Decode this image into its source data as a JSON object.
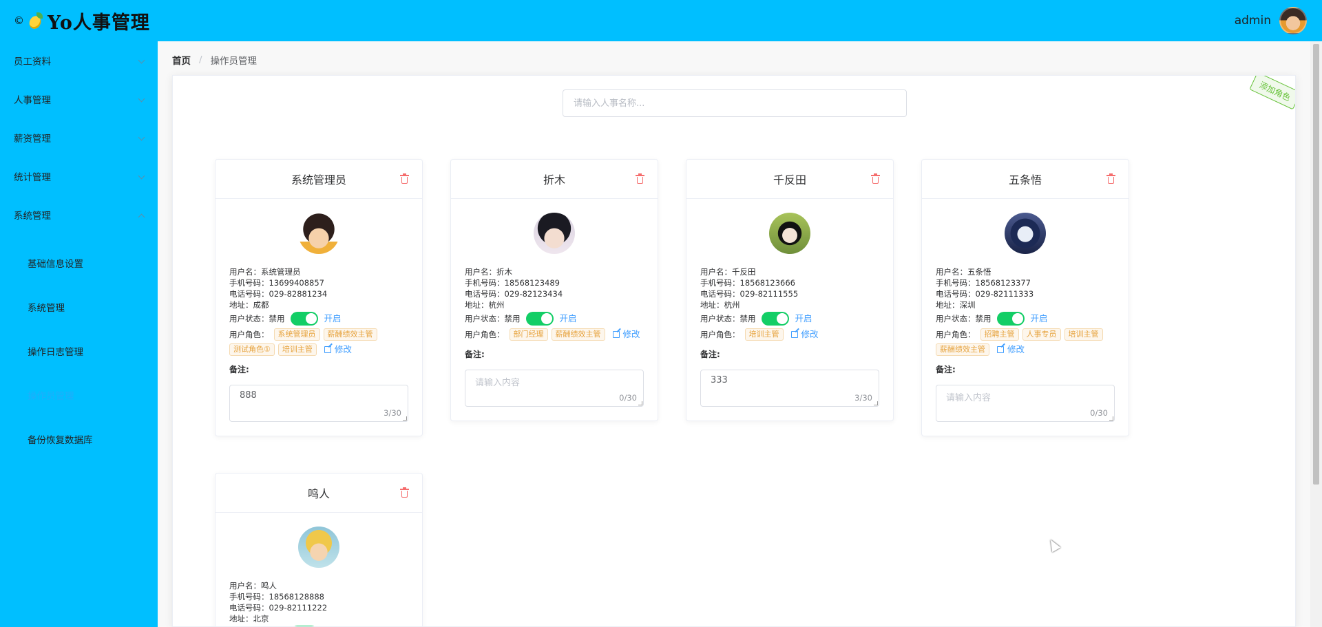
{
  "header": {
    "copyright": "©",
    "logo_icon": "pineapple-icon",
    "title": "Yo人事管理",
    "username": "admin"
  },
  "sidebar": {
    "items": [
      {
        "label": "员工资料"
      },
      {
        "label": "人事管理"
      },
      {
        "label": "薪资管理"
      },
      {
        "label": "统计管理"
      },
      {
        "label": "系统管理"
      }
    ],
    "sub_items": [
      {
        "label": "基础信息设置"
      },
      {
        "label": "系统管理"
      },
      {
        "label": "操作日志管理"
      },
      {
        "label": "操作员管理"
      },
      {
        "label": "备份恢复数据库"
      }
    ]
  },
  "breadcrumb": {
    "home": "首页",
    "separator": "/",
    "current": "操作员管理"
  },
  "add_role_label": "添加角色",
  "search": {
    "placeholder": "请输入人事名称..."
  },
  "labels": {
    "username": "用户名：",
    "mobile": "手机号码：",
    "phone": "电话号码：",
    "address": "地址：",
    "status": "用户状态：",
    "status_off": "禁用",
    "status_on": "开启",
    "roles": "用户角色：",
    "edit": "修改",
    "remark": "备注:",
    "remark_placeholder": "请输入内容"
  },
  "operators": [
    {
      "title": "系统管理员",
      "username": "系统管理员",
      "mobile": "13699408857",
      "phone": "029-82881234",
      "address": "成都",
      "enabled": true,
      "roles": [
        "系统管理员",
        "薪酬绩效主管",
        "测试角色①",
        "培训主管"
      ],
      "remark": "888",
      "count": "3/30"
    },
    {
      "title": "折木",
      "username": "折木",
      "mobile": "18568123489",
      "phone": "029-82123434",
      "address": "杭州",
      "enabled": true,
      "roles": [
        "部门经理",
        "薪酬绩效主管"
      ],
      "remark": "",
      "count": "0/30"
    },
    {
      "title": "千反田",
      "username": "千反田",
      "mobile": "18568123666",
      "phone": "029-82111555",
      "address": "杭州",
      "enabled": true,
      "roles": [
        "培训主管"
      ],
      "remark": "333",
      "count": "3/30"
    },
    {
      "title": "五条悟",
      "username": "五条悟",
      "mobile": "18568123377",
      "phone": "029-82111333",
      "address": "深圳",
      "enabled": true,
      "roles": [
        "招聘主管",
        "人事专员",
        "培训主管",
        "薪酬绩效主管"
      ],
      "remark": "",
      "count": "0/30"
    },
    {
      "title": "鸣人",
      "username": "鸣人",
      "mobile": "18568128888",
      "phone": "029-82111222",
      "address": "北京",
      "enabled": true,
      "roles": [],
      "remark": "",
      "count": ""
    }
  ],
  "colors": {
    "brand": "#00bfff",
    "switch_on": "#13ce66",
    "link": "#409eff",
    "tag": "#e6a23c",
    "delete": "#f56c6c"
  }
}
